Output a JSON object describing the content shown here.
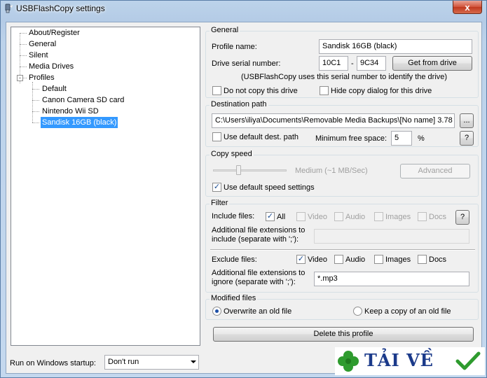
{
  "window": {
    "title": "USBFlashCopy settings",
    "close_glyph": "x"
  },
  "tree": {
    "items": [
      {
        "label": "About/Register"
      },
      {
        "label": "General"
      },
      {
        "label": "Silent"
      },
      {
        "label": "Media Drives"
      },
      {
        "label": "Profiles",
        "expander": "-"
      },
      {
        "label": "Default"
      },
      {
        "label": "Canon Camera SD card"
      },
      {
        "label": "Nintendo Wii SD"
      },
      {
        "label": "Sandisk 16GB (black)",
        "selected": true
      }
    ]
  },
  "general": {
    "label": "General",
    "profile_name_label": "Profile name:",
    "profile_name_value": "Sandisk 16GB (black)",
    "serial_label": "Drive serial number:",
    "serial_part1": "10C1",
    "serial_dash": "-",
    "serial_part2": "9C34",
    "get_from_drive_button": "Get from drive",
    "serial_note": "(USBFlashCopy uses this serial number to identify the drive)",
    "do_not_copy_label": "Do not copy this drive",
    "hide_dialog_label": "Hide copy dialog for this drive"
  },
  "destination": {
    "label": "Destination path",
    "path_value": "C:\\Users\\iliya\\Documents\\Removable Media Backups\\[No name] 3.78",
    "browse_button": "...",
    "use_default_label": "Use default dest. path",
    "min_free_label": "Minimum free space:",
    "min_free_value": "5",
    "percent": "%",
    "help_button": "?"
  },
  "copy_speed": {
    "label": "Copy speed",
    "speed_text": "Medium (~1 MB/Sec)",
    "advanced_button": "Advanced",
    "use_default_label": "Use default speed settings"
  },
  "filter": {
    "label": "Filter",
    "include_label": "Include files:",
    "include_options": [
      {
        "label": "All",
        "checked": true,
        "disabled": false
      },
      {
        "label": "Video",
        "checked": false,
        "disabled": true
      },
      {
        "label": "Audio",
        "checked": false,
        "disabled": true
      },
      {
        "label": "Images",
        "checked": false,
        "disabled": true
      },
      {
        "label": "Docs",
        "checked": false,
        "disabled": true
      }
    ],
    "help_button": "?",
    "additional_include_label": "Additional file extensions to\ninclude (separate with ';'):",
    "additional_include_line1": "Additional file extensions to",
    "additional_include_line2": "include (separate with ';'):",
    "additional_include_value": "",
    "exclude_label": "Exclude files:",
    "exclude_options": [
      {
        "label": "Video",
        "checked": true
      },
      {
        "label": "Audio",
        "checked": false
      },
      {
        "label": "Images",
        "checked": false
      },
      {
        "label": "Docs",
        "checked": false
      }
    ],
    "additional_ignore_line1": "Additional file extensions to",
    "additional_ignore_line2": "ignore (separate with ';'):",
    "additional_ignore_value": "*.mp3"
  },
  "modified": {
    "label": "Modified files",
    "overwrite_label": "Overwrite an old file",
    "keep_copy_label": "Keep a copy of an old file"
  },
  "delete_profile_button": "Delete this profile",
  "startup": {
    "label": "Run on Windows startup:",
    "value": "Don't run"
  },
  "watermark": {
    "text": "TẢI VỀ"
  },
  "colors": {
    "selection": "#3399ff",
    "panel": "#f0f0f0",
    "watermark_text": "#1b3a8a",
    "clover": "#2e9b2e"
  }
}
